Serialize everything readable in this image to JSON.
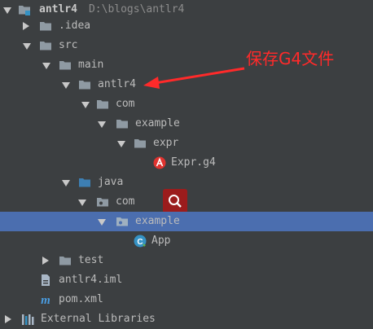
{
  "colors": {
    "background": "#3c3f41",
    "selection": "#4b6eaf",
    "folder": "#8f9aa3",
    "source_folder": "#3d7fb3",
    "annotation": "#ff2a2a"
  },
  "tree": {
    "root": {
      "label": "antlr4",
      "path": "D:\\blogs\\antlr4"
    },
    "idea": {
      "label": ".idea"
    },
    "src": {
      "label": "src"
    },
    "main": {
      "label": "main"
    },
    "antlr4": {
      "label": "antlr4"
    },
    "com1": {
      "label": "com"
    },
    "example1": {
      "label": "example"
    },
    "expr": {
      "label": "expr"
    },
    "exprg4": {
      "label": "Expr.g4",
      "icon": "antlr-icon"
    },
    "java": {
      "label": "java"
    },
    "com2": {
      "label": "com"
    },
    "example2": {
      "label": "example"
    },
    "app": {
      "label": "App",
      "icon": "java-class-icon"
    },
    "test": {
      "label": "test"
    },
    "iml": {
      "label": "antlr4.iml"
    },
    "pom": {
      "label": "pom.xml"
    },
    "libs": {
      "label": "External Libraries"
    }
  },
  "annotation": {
    "text": "保存G4文件"
  }
}
